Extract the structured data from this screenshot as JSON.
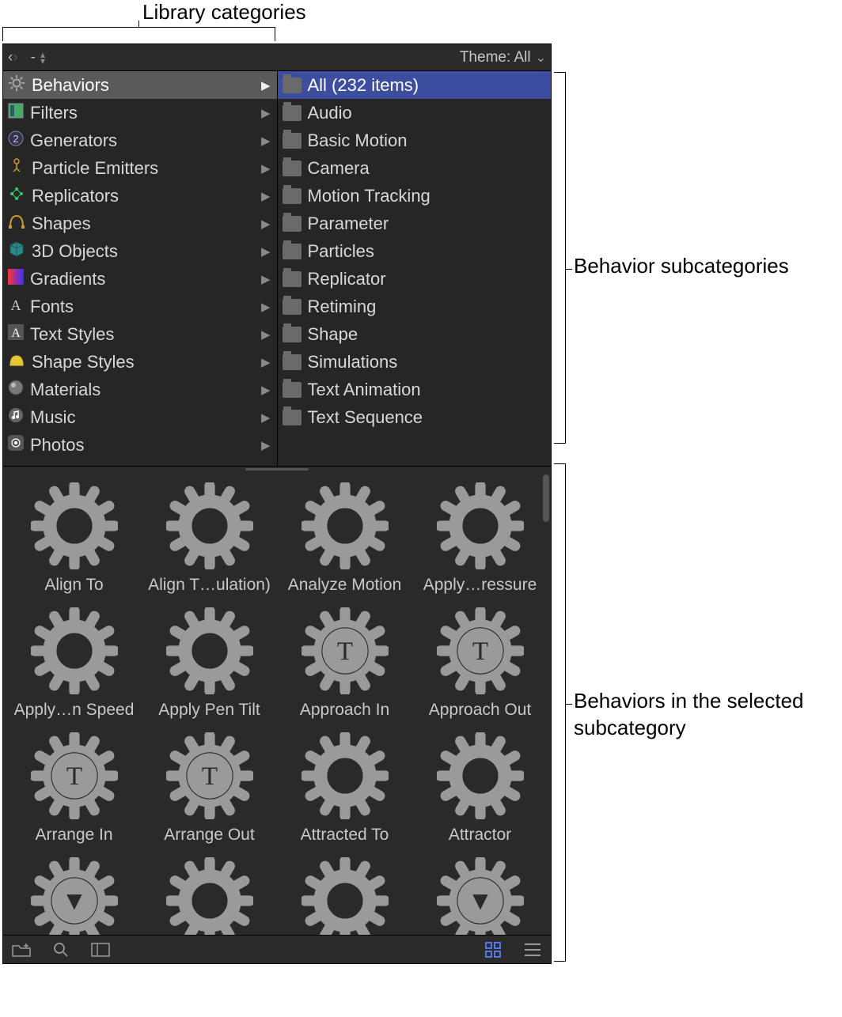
{
  "annotations": {
    "top": "Library categories",
    "right1": "Behavior subcategories",
    "right2": "Behaviors in the selected subcategory"
  },
  "toolbar": {
    "path_display": "-",
    "theme_label": "Theme: All"
  },
  "categories": [
    {
      "label": "Behaviors",
      "icon": "gear",
      "selected": true
    },
    {
      "label": "Filters",
      "icon": "filter"
    },
    {
      "label": "Generators",
      "icon": "generator"
    },
    {
      "label": "Particle Emitters",
      "icon": "particle"
    },
    {
      "label": "Replicators",
      "icon": "replicator"
    },
    {
      "label": "Shapes",
      "icon": "shape"
    },
    {
      "label": "3D Objects",
      "icon": "cube"
    },
    {
      "label": "Gradients",
      "icon": "gradient"
    },
    {
      "label": "Fonts",
      "icon": "font"
    },
    {
      "label": "Text Styles",
      "icon": "textstyle"
    },
    {
      "label": "Shape Styles",
      "icon": "shapestyle"
    },
    {
      "label": "Materials",
      "icon": "material"
    },
    {
      "label": "Music",
      "icon": "music"
    },
    {
      "label": "Photos",
      "icon": "photos"
    }
  ],
  "subcategories": [
    {
      "label": "All (232 items)",
      "selected": true
    },
    {
      "label": "Audio"
    },
    {
      "label": "Basic Motion"
    },
    {
      "label": "Camera"
    },
    {
      "label": "Motion Tracking"
    },
    {
      "label": "Parameter"
    },
    {
      "label": "Particles"
    },
    {
      "label": "Replicator"
    },
    {
      "label": "Retiming"
    },
    {
      "label": "Shape"
    },
    {
      "label": "Simulations"
    },
    {
      "label": "Text Animation"
    },
    {
      "label": "Text Sequence"
    }
  ],
  "grid_items": [
    {
      "label": "Align To",
      "glyph": ""
    },
    {
      "label": "Align T…ulation)",
      "glyph": ""
    },
    {
      "label": "Analyze Motion",
      "glyph": ""
    },
    {
      "label": "Apply…ressure",
      "glyph": ""
    },
    {
      "label": "Apply…n Speed",
      "glyph": ""
    },
    {
      "label": "Apply Pen Tilt",
      "glyph": ""
    },
    {
      "label": "Approach In",
      "glyph": "T"
    },
    {
      "label": "Approach Out",
      "glyph": "T"
    },
    {
      "label": "Arrange In",
      "glyph": "T"
    },
    {
      "label": "Arrange Out",
      "glyph": "T"
    },
    {
      "label": "Attracted To",
      "glyph": ""
    },
    {
      "label": "Attractor",
      "glyph": ""
    },
    {
      "label": "",
      "glyph": "▼",
      "partial": true
    },
    {
      "label": "",
      "glyph": "",
      "partial": true
    },
    {
      "label": "",
      "glyph": "",
      "partial": true
    },
    {
      "label": "",
      "glyph": "▼",
      "partial": true
    }
  ]
}
